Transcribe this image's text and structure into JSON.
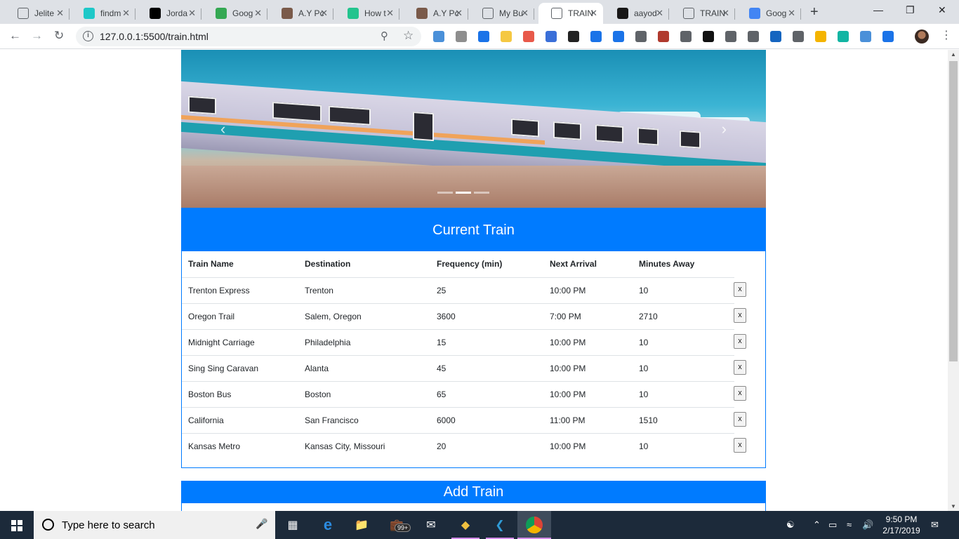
{
  "browser": {
    "tabs": [
      {
        "title": "Jelite",
        "icon": "doc-icon",
        "color": "#5f6368"
      },
      {
        "title": "findm",
        "icon": "findmyshift-icon",
        "color": "#1ec8c8"
      },
      {
        "title": "Jorda",
        "icon": "jw-icon",
        "color": "#000000"
      },
      {
        "title": "Goog",
        "icon": "google-sheets-icon",
        "color": "#34a853"
      },
      {
        "title": "A.Y Pc",
        "icon": "profile-photo-icon",
        "color": "#7a5a4a"
      },
      {
        "title": "How t",
        "icon": "chat-icon",
        "color": "#23c48e"
      },
      {
        "title": "A.Y Pc",
        "icon": "profile-photo-icon",
        "color": "#7a5a4a"
      },
      {
        "title": "My Bu",
        "icon": "doc-icon",
        "color": "#5f6368"
      },
      {
        "title": "TRAIN",
        "icon": "doc-icon",
        "color": "#5f6368",
        "active": true
      },
      {
        "title": "aayod",
        "icon": "github-icon",
        "color": "#181717"
      },
      {
        "title": "TRAIN",
        "icon": "doc-icon",
        "color": "#5f6368"
      },
      {
        "title": "Goog",
        "icon": "google-icon",
        "color": "#4285f4"
      }
    ],
    "url": "127.0.0.1:5500/train.html",
    "extensions": [
      "#4a90d9",
      "#8e8e8e",
      "#1a73e8",
      "#f5c842",
      "#e8594a",
      "#3a6fd8",
      "#222222",
      "#1a73e8",
      "#1a73e8",
      "#5f6368",
      "#b03a2e",
      "#5f6368",
      "#111111",
      "#5f6368",
      "#5f6368",
      "#1565c0",
      "#5f6368",
      "#f4b400",
      "#12b5a3",
      "#4a90d9",
      "#1a73e8"
    ]
  },
  "page": {
    "current_train_title": "Current Train",
    "add_train_title": "Add Train",
    "columns": [
      "Train Name",
      "Destination",
      "Frequency (min)",
      "Next Arrival",
      "Minutes Away"
    ],
    "rows": [
      [
        "Trenton Express",
        "Trenton",
        "25",
        "10:00 PM",
        "10"
      ],
      [
        "Oregon Trail",
        "Salem, Oregon",
        "3600",
        "7:00 PM",
        "2710"
      ],
      [
        "Midnight Carriage",
        "Philadelphia",
        "15",
        "10:00 PM",
        "10"
      ],
      [
        "Sing Sing Caravan",
        "Alanta",
        "45",
        "10:00 PM",
        "10"
      ],
      [
        "Boston Bus",
        "Boston",
        "65",
        "10:00 PM",
        "10"
      ],
      [
        "California",
        "San Francisco",
        "6000",
        "11:00 PM",
        "1510"
      ],
      [
        "Kansas Metro",
        "Kansas City, Missouri",
        "20",
        "10:00 PM",
        "10"
      ]
    ],
    "remove_label": "x",
    "accent_color": "#007bff"
  },
  "taskbar": {
    "search_placeholder": "Type here to search",
    "badge": "99+",
    "time": "9:50 PM",
    "date": "2/17/2019"
  }
}
